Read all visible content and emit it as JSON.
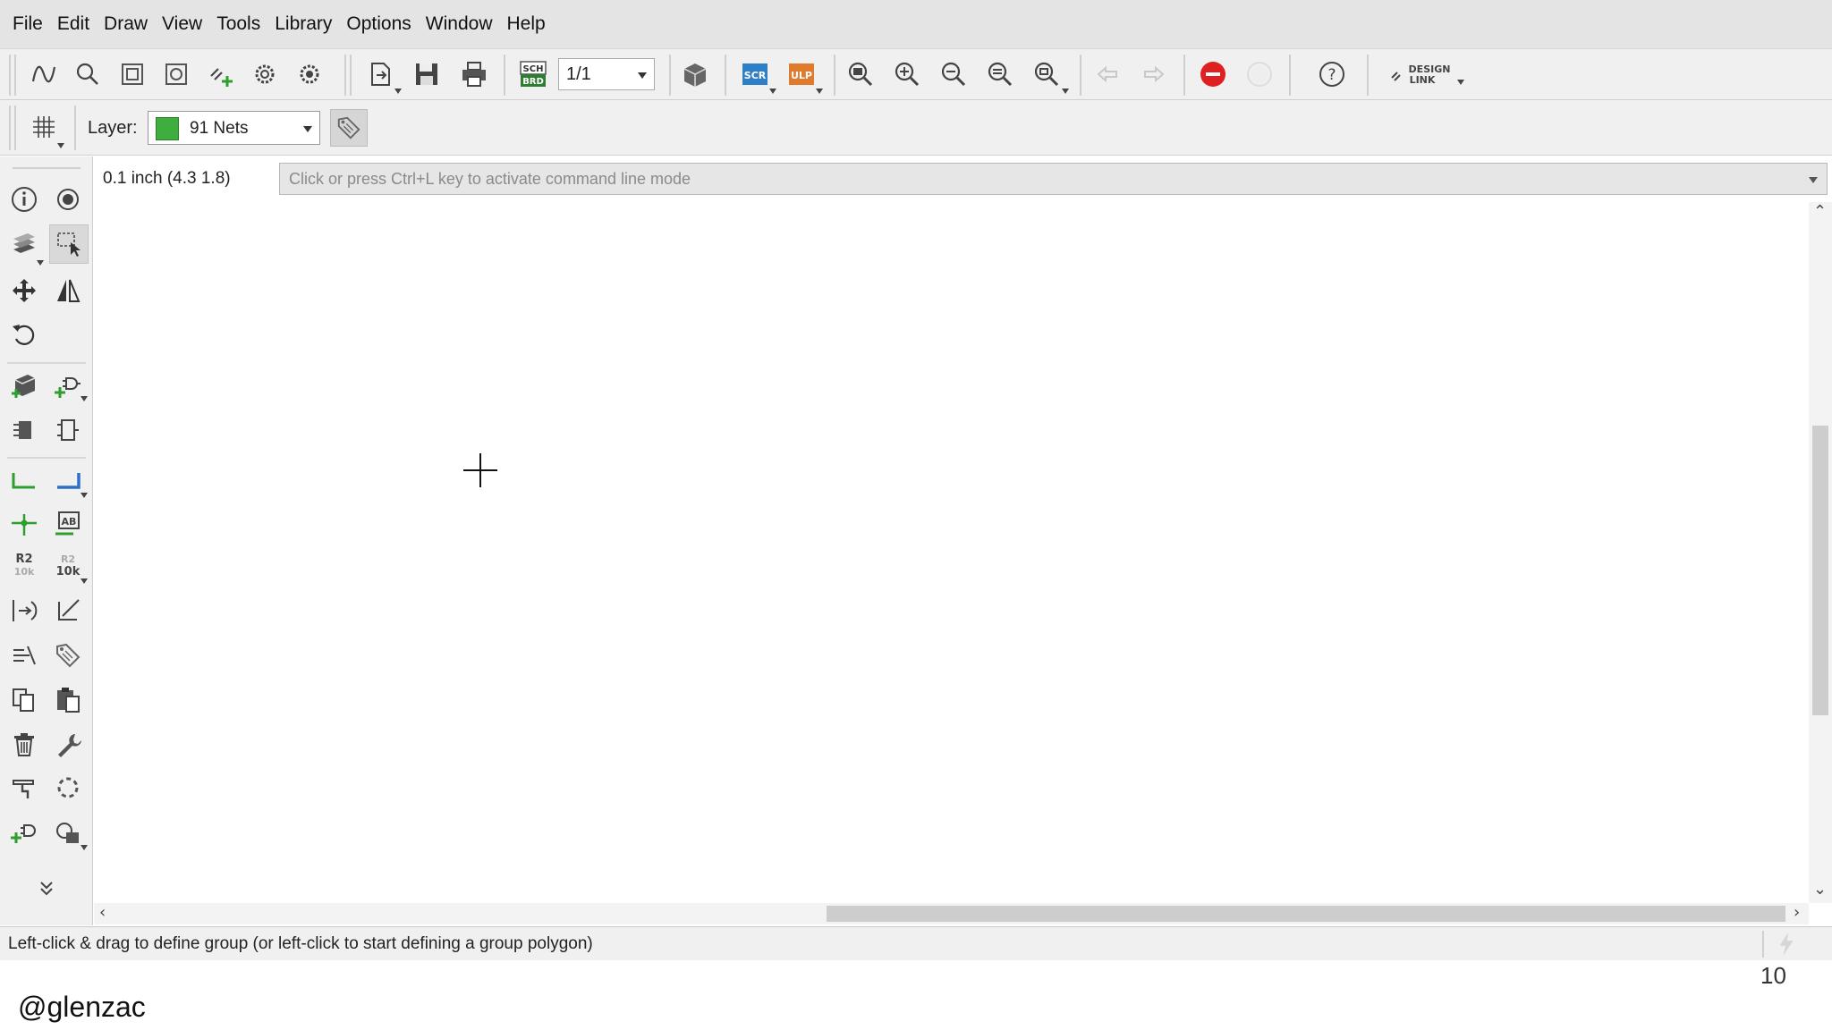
{
  "menubar": {
    "items": [
      {
        "label": "File"
      },
      {
        "label": "Edit"
      },
      {
        "label": "Draw"
      },
      {
        "label": "View"
      },
      {
        "label": "Tools"
      },
      {
        "label": "Library"
      },
      {
        "label": "Options"
      },
      {
        "label": "Window"
      },
      {
        "label": "Help"
      }
    ]
  },
  "toolbar": {
    "sheet_value": "1/1",
    "scr_label": "SCR",
    "ulp_label": "ULP",
    "sch_label": "SCH",
    "brd_label": "BRD",
    "design_link_label": "DESIGN",
    "design_link_label2": "LINK"
  },
  "layerbar": {
    "label": "Layer:",
    "selected_layer": "91 Nets",
    "layer_color": "#3fae3f"
  },
  "command": {
    "coordinate_readout": "0.1 inch (4.3 1.8)",
    "placeholder": "Click or press Ctrl+L key to activate command line mode"
  },
  "leftpanel": {
    "r2_label": "R2",
    "r2_sub": "10k",
    "r2b_label": "R2",
    "r2b_sub": "10k"
  },
  "statusbar": {
    "hint": "Left-click & drag to define group (or left-click to start defining a group polygon)"
  },
  "footer": {
    "page_number": "10",
    "handle": "@glenzac"
  }
}
